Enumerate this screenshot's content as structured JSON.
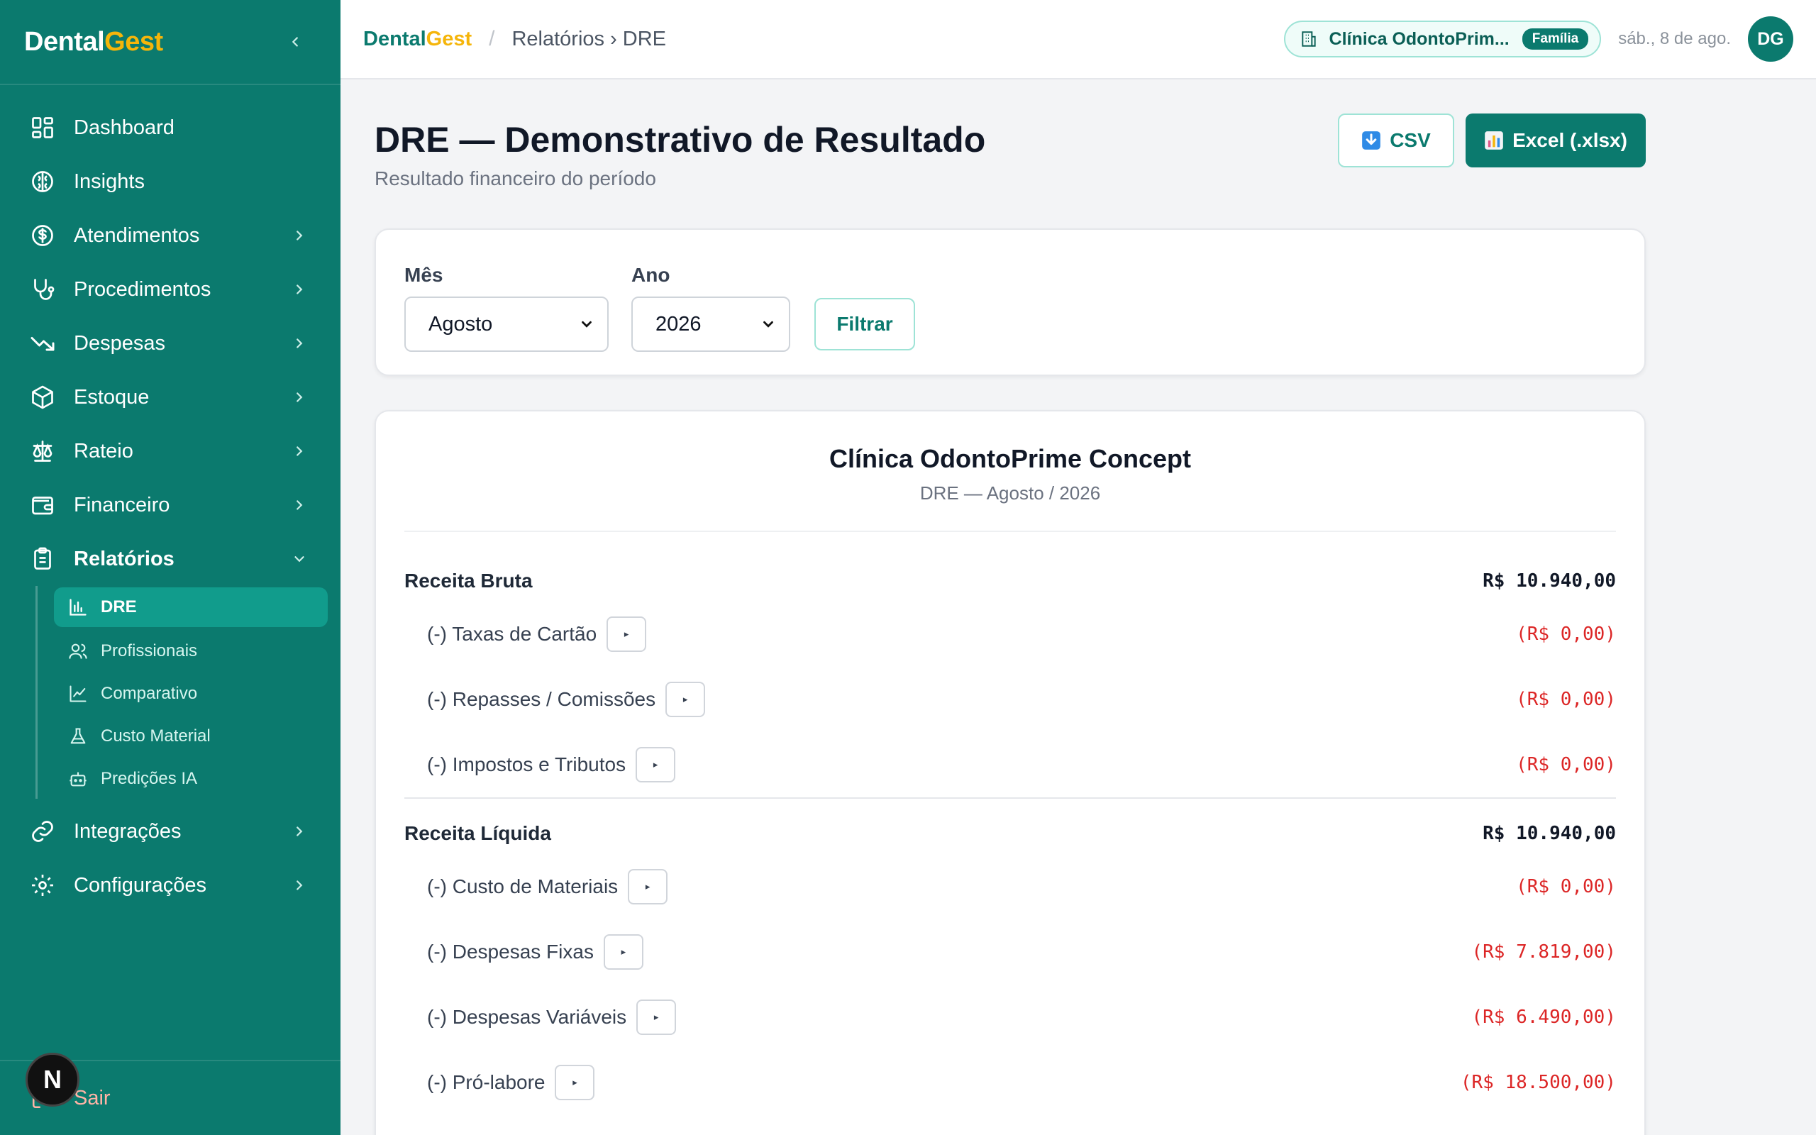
{
  "app": {
    "brand_part1": "Dental",
    "brand_part2": "Gest",
    "accent": "#0b7a6e",
    "brand_yellow": "#f5b50a"
  },
  "sidebar": {
    "items": [
      {
        "label": "Dashboard",
        "icon": "dashboard-icon"
      },
      {
        "label": "Insights",
        "icon": "brain-icon"
      },
      {
        "label": "Atendimentos",
        "icon": "dollar-circle-icon"
      },
      {
        "label": "Procedimentos",
        "icon": "stethoscope-icon"
      },
      {
        "label": "Despesas",
        "icon": "trending-down-icon"
      },
      {
        "label": "Estoque",
        "icon": "box-icon"
      },
      {
        "label": "Rateio",
        "icon": "scale-icon"
      },
      {
        "label": "Financeiro",
        "icon": "wallet-icon"
      },
      {
        "label": "Relatórios",
        "icon": "clipboard-icon"
      },
      {
        "label": "Integrações",
        "icon": "link-icon"
      },
      {
        "label": "Configurações",
        "icon": "gear-icon"
      }
    ],
    "sub_items": [
      {
        "label": "DRE",
        "icon": "bar-chart-icon"
      },
      {
        "label": "Profissionais",
        "icon": "users-icon"
      },
      {
        "label": "Comparativo",
        "icon": "line-chart-icon"
      },
      {
        "label": "Custo Material",
        "icon": "flask-icon"
      },
      {
        "label": "Predições IA",
        "icon": "robot-icon"
      }
    ],
    "logout_label": "Sair",
    "badge_letter": "N"
  },
  "topbar": {
    "breadcrumb_path": "Relatórios › DRE",
    "clinic_name": "Clínica OdontoPrim...",
    "plan_badge": "Família",
    "date": "sáb., 8 de ago.",
    "avatar_initials": "DG"
  },
  "page": {
    "title": "DRE — Demonstrativo de Resultado",
    "subtitle": "Resultado financeiro do período",
    "csv_label": "CSV",
    "excel_label": "Excel (.xlsx)"
  },
  "filters": {
    "month_label": "Mês",
    "month_value": "Agosto",
    "year_label": "Ano",
    "year_value": "2026",
    "filter_button": "Filtrar"
  },
  "report": {
    "clinic": "Clínica OdontoPrime Concept",
    "period": "DRE — Agosto / 2026",
    "gross_revenue": {
      "label": "Receita Bruta",
      "amount": "R$ 10.940,00"
    },
    "gross_deductions": [
      {
        "label": "(-) Taxas de Cartão",
        "amount": "(R$ 0,00)"
      },
      {
        "label": "(-) Repasses / Comissões",
        "amount": "(R$ 0,00)"
      },
      {
        "label": "(-) Impostos e Tributos",
        "amount": "(R$ 0,00)"
      }
    ],
    "net_revenue": {
      "label": "Receita Líquida",
      "amount": "R$ 10.940,00"
    },
    "net_deductions": [
      {
        "label": "(-) Custo de Materiais",
        "amount": "(R$ 0,00)"
      },
      {
        "label": "(-) Despesas Fixas",
        "amount": "(R$ 7.819,00)"
      },
      {
        "label": "(-) Despesas Variáveis",
        "amount": "(R$ 6.490,00)"
      },
      {
        "label": "(-) Pró-labore",
        "amount": "(R$ 18.500,00)"
      }
    ],
    "expand_glyph": "▸"
  }
}
